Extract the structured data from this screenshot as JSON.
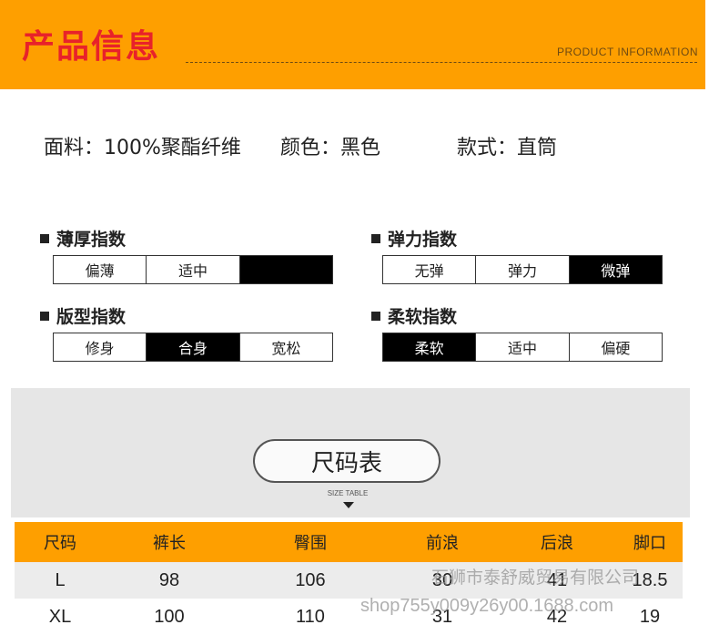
{
  "header": {
    "title": "产品信息",
    "subtitle": "PRODUCT  INFORMATION"
  },
  "info": {
    "fabric": "面料：100%聚酯纤维",
    "color": "颜色：黑色",
    "style": "款式：直筒"
  },
  "indices": [
    {
      "title": "薄厚指数",
      "options": [
        "偏薄",
        "适中",
        ""
      ],
      "active": 2
    },
    {
      "title": "弹力指数",
      "options": [
        "无弹",
        "弹力",
        "微弹"
      ],
      "active": 2
    },
    {
      "title": "版型指数",
      "options": [
        "修身",
        "合身",
        "宽松"
      ],
      "active": 1
    },
    {
      "title": "柔软指数",
      "options": [
        "柔软",
        "适中",
        "偏硬"
      ],
      "active": 0
    }
  ],
  "size_section": {
    "title": "尺码表",
    "subtitle": "SIZE TABLE"
  },
  "size_table": {
    "headers": [
      "尺码",
      "裤长",
      "臀围",
      "前浪",
      "后浪",
      "脚口"
    ],
    "rows": [
      [
        "L",
        "98",
        "106",
        "30",
        "41",
        "18.5"
      ],
      [
        "XL",
        "100",
        "110",
        "31",
        "42",
        "19"
      ]
    ]
  },
  "watermark": {
    "line1": "石狮市泰舒威贸易有限公司",
    "line2": "shop755y009y26y00.1688.com"
  },
  "colors": {
    "accent": "#fe9f00",
    "title_red": "#e8222a",
    "active_black": "#000000"
  }
}
